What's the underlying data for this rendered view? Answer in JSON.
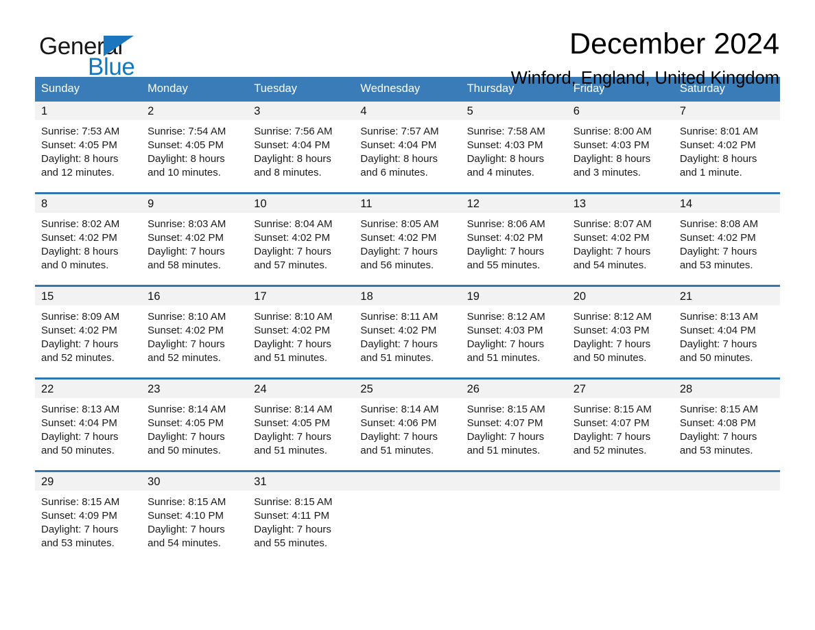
{
  "brand": {
    "name_part1": "General",
    "name_part2": "Blue",
    "accent_color": "#1b76bd"
  },
  "header": {
    "title": "December 2024",
    "location": "Winford, England, United Kingdom"
  },
  "calendar": {
    "header_bg": "#3a7cb8",
    "row_divider_color": "#2f76b5",
    "day_band_bg": "#f2f2f2",
    "weekdays": [
      "Sunday",
      "Monday",
      "Tuesday",
      "Wednesday",
      "Thursday",
      "Friday",
      "Saturday"
    ],
    "weeks": [
      [
        {
          "day": "1",
          "lines": [
            "Sunrise: 7:53 AM",
            "Sunset: 4:05 PM",
            "Daylight: 8 hours",
            "and 12 minutes."
          ]
        },
        {
          "day": "2",
          "lines": [
            "Sunrise: 7:54 AM",
            "Sunset: 4:05 PM",
            "Daylight: 8 hours",
            "and 10 minutes."
          ]
        },
        {
          "day": "3",
          "lines": [
            "Sunrise: 7:56 AM",
            "Sunset: 4:04 PM",
            "Daylight: 8 hours",
            "and 8 minutes."
          ]
        },
        {
          "day": "4",
          "lines": [
            "Sunrise: 7:57 AM",
            "Sunset: 4:04 PM",
            "Daylight: 8 hours",
            "and 6 minutes."
          ]
        },
        {
          "day": "5",
          "lines": [
            "Sunrise: 7:58 AM",
            "Sunset: 4:03 PM",
            "Daylight: 8 hours",
            "and 4 minutes."
          ]
        },
        {
          "day": "6",
          "lines": [
            "Sunrise: 8:00 AM",
            "Sunset: 4:03 PM",
            "Daylight: 8 hours",
            "and 3 minutes."
          ]
        },
        {
          "day": "7",
          "lines": [
            "Sunrise: 8:01 AM",
            "Sunset: 4:02 PM",
            "Daylight: 8 hours",
            "and 1 minute."
          ]
        }
      ],
      [
        {
          "day": "8",
          "lines": [
            "Sunrise: 8:02 AM",
            "Sunset: 4:02 PM",
            "Daylight: 8 hours",
            "and 0 minutes."
          ]
        },
        {
          "day": "9",
          "lines": [
            "Sunrise: 8:03 AM",
            "Sunset: 4:02 PM",
            "Daylight: 7 hours",
            "and 58 minutes."
          ]
        },
        {
          "day": "10",
          "lines": [
            "Sunrise: 8:04 AM",
            "Sunset: 4:02 PM",
            "Daylight: 7 hours",
            "and 57 minutes."
          ]
        },
        {
          "day": "11",
          "lines": [
            "Sunrise: 8:05 AM",
            "Sunset: 4:02 PM",
            "Daylight: 7 hours",
            "and 56 minutes."
          ]
        },
        {
          "day": "12",
          "lines": [
            "Sunrise: 8:06 AM",
            "Sunset: 4:02 PM",
            "Daylight: 7 hours",
            "and 55 minutes."
          ]
        },
        {
          "day": "13",
          "lines": [
            "Sunrise: 8:07 AM",
            "Sunset: 4:02 PM",
            "Daylight: 7 hours",
            "and 54 minutes."
          ]
        },
        {
          "day": "14",
          "lines": [
            "Sunrise: 8:08 AM",
            "Sunset: 4:02 PM",
            "Daylight: 7 hours",
            "and 53 minutes."
          ]
        }
      ],
      [
        {
          "day": "15",
          "lines": [
            "Sunrise: 8:09 AM",
            "Sunset: 4:02 PM",
            "Daylight: 7 hours",
            "and 52 minutes."
          ]
        },
        {
          "day": "16",
          "lines": [
            "Sunrise: 8:10 AM",
            "Sunset: 4:02 PM",
            "Daylight: 7 hours",
            "and 52 minutes."
          ]
        },
        {
          "day": "17",
          "lines": [
            "Sunrise: 8:10 AM",
            "Sunset: 4:02 PM",
            "Daylight: 7 hours",
            "and 51 minutes."
          ]
        },
        {
          "day": "18",
          "lines": [
            "Sunrise: 8:11 AM",
            "Sunset: 4:02 PM",
            "Daylight: 7 hours",
            "and 51 minutes."
          ]
        },
        {
          "day": "19",
          "lines": [
            "Sunrise: 8:12 AM",
            "Sunset: 4:03 PM",
            "Daylight: 7 hours",
            "and 51 minutes."
          ]
        },
        {
          "day": "20",
          "lines": [
            "Sunrise: 8:12 AM",
            "Sunset: 4:03 PM",
            "Daylight: 7 hours",
            "and 50 minutes."
          ]
        },
        {
          "day": "21",
          "lines": [
            "Sunrise: 8:13 AM",
            "Sunset: 4:04 PM",
            "Daylight: 7 hours",
            "and 50 minutes."
          ]
        }
      ],
      [
        {
          "day": "22",
          "lines": [
            "Sunrise: 8:13 AM",
            "Sunset: 4:04 PM",
            "Daylight: 7 hours",
            "and 50 minutes."
          ]
        },
        {
          "day": "23",
          "lines": [
            "Sunrise: 8:14 AM",
            "Sunset: 4:05 PM",
            "Daylight: 7 hours",
            "and 50 minutes."
          ]
        },
        {
          "day": "24",
          "lines": [
            "Sunrise: 8:14 AM",
            "Sunset: 4:05 PM",
            "Daylight: 7 hours",
            "and 51 minutes."
          ]
        },
        {
          "day": "25",
          "lines": [
            "Sunrise: 8:14 AM",
            "Sunset: 4:06 PM",
            "Daylight: 7 hours",
            "and 51 minutes."
          ]
        },
        {
          "day": "26",
          "lines": [
            "Sunrise: 8:15 AM",
            "Sunset: 4:07 PM",
            "Daylight: 7 hours",
            "and 51 minutes."
          ]
        },
        {
          "day": "27",
          "lines": [
            "Sunrise: 8:15 AM",
            "Sunset: 4:07 PM",
            "Daylight: 7 hours",
            "and 52 minutes."
          ]
        },
        {
          "day": "28",
          "lines": [
            "Sunrise: 8:15 AM",
            "Sunset: 4:08 PM",
            "Daylight: 7 hours",
            "and 53 minutes."
          ]
        }
      ],
      [
        {
          "day": "29",
          "lines": [
            "Sunrise: 8:15 AM",
            "Sunset: 4:09 PM",
            "Daylight: 7 hours",
            "and 53 minutes."
          ]
        },
        {
          "day": "30",
          "lines": [
            "Sunrise: 8:15 AM",
            "Sunset: 4:10 PM",
            "Daylight: 7 hours",
            "and 54 minutes."
          ]
        },
        {
          "day": "31",
          "lines": [
            "Sunrise: 8:15 AM",
            "Sunset: 4:11 PM",
            "Daylight: 7 hours",
            "and 55 minutes."
          ]
        },
        {
          "day": "",
          "lines": []
        },
        {
          "day": "",
          "lines": []
        },
        {
          "day": "",
          "lines": []
        },
        {
          "day": "",
          "lines": []
        }
      ]
    ]
  }
}
